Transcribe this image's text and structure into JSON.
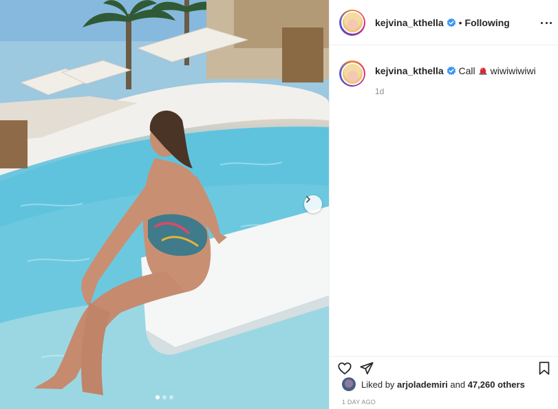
{
  "post": {
    "image_description_icon": "photo",
    "carousel": {
      "total_slides": 3,
      "active_slide": 1,
      "next_icon": "chevron-right-icon"
    }
  },
  "header": {
    "username": "kejvina_kthella",
    "verified_icon": "verified-badge-icon",
    "separator": "•",
    "follow_label": "Following",
    "more_icon": "more-options-icon"
  },
  "caption": {
    "username": "kejvina_kthella",
    "text_before": "Call",
    "emoji_icon": "police-light-icon",
    "text_after": "wiwiwiwiwi",
    "time": "1d"
  },
  "actions": {
    "like_icon": "heart-icon",
    "share_icon": "paper-plane-icon",
    "save_icon": "bookmark-icon"
  },
  "likes": {
    "prefix": "Liked by",
    "user": "arjolademiri",
    "middle": "and",
    "count": "47,260 others"
  },
  "timestamp": "1 day ago",
  "colors": {
    "verified": "#3897f0",
    "text": "#262626",
    "muted": "#8e8e8e",
    "divider": "#efefef"
  }
}
